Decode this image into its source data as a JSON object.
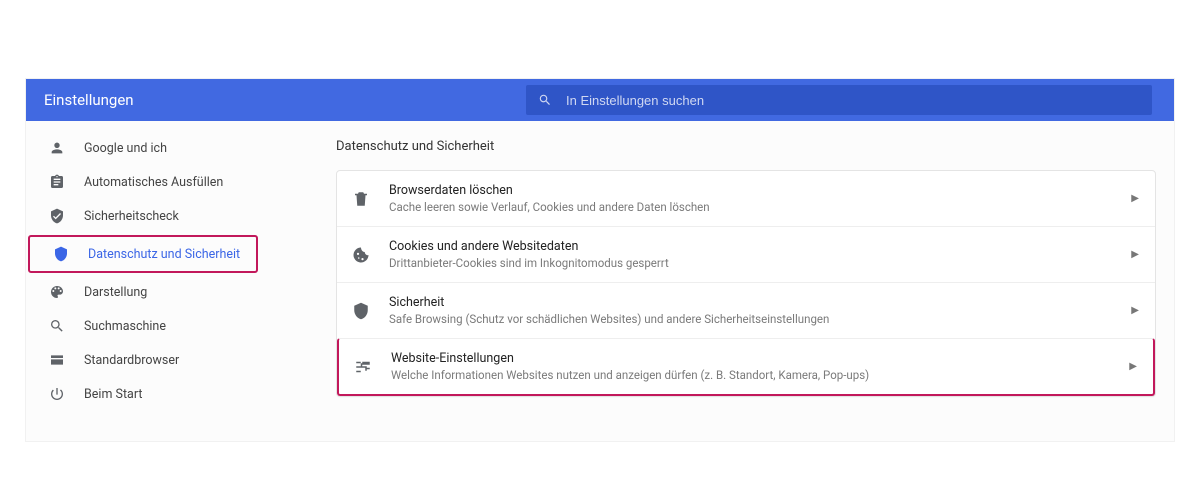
{
  "header": {
    "title": "Einstellungen"
  },
  "search": {
    "placeholder": "In Einstellungen suchen"
  },
  "sidebar": {
    "items": [
      {
        "label": "Google und ich"
      },
      {
        "label": "Automatisches Ausfüllen"
      },
      {
        "label": "Sicherheitscheck"
      },
      {
        "label": "Datenschutz und Sicherheit"
      },
      {
        "label": "Darstellung"
      },
      {
        "label": "Suchmaschine"
      },
      {
        "label": "Standardbrowser"
      },
      {
        "label": "Beim Start"
      }
    ]
  },
  "main": {
    "section_title": "Datenschutz und Sicherheit",
    "rows": [
      {
        "title": "Browserdaten löschen",
        "desc": "Cache leeren sowie Verlauf, Cookies und andere Daten löschen"
      },
      {
        "title": "Cookies und andere Websitedaten",
        "desc": "Drittanbieter-Cookies sind im Inkognitomodus gesperrt"
      },
      {
        "title": "Sicherheit",
        "desc": "Safe Browsing (Schutz vor schädlichen Websites) und andere Sicherheitseinstellungen"
      },
      {
        "title": "Website-Einstellungen",
        "desc": "Welche Informationen Websites nutzen und anzeigen dürfen (z. B. Standort, Kamera, Pop-ups)"
      }
    ]
  }
}
